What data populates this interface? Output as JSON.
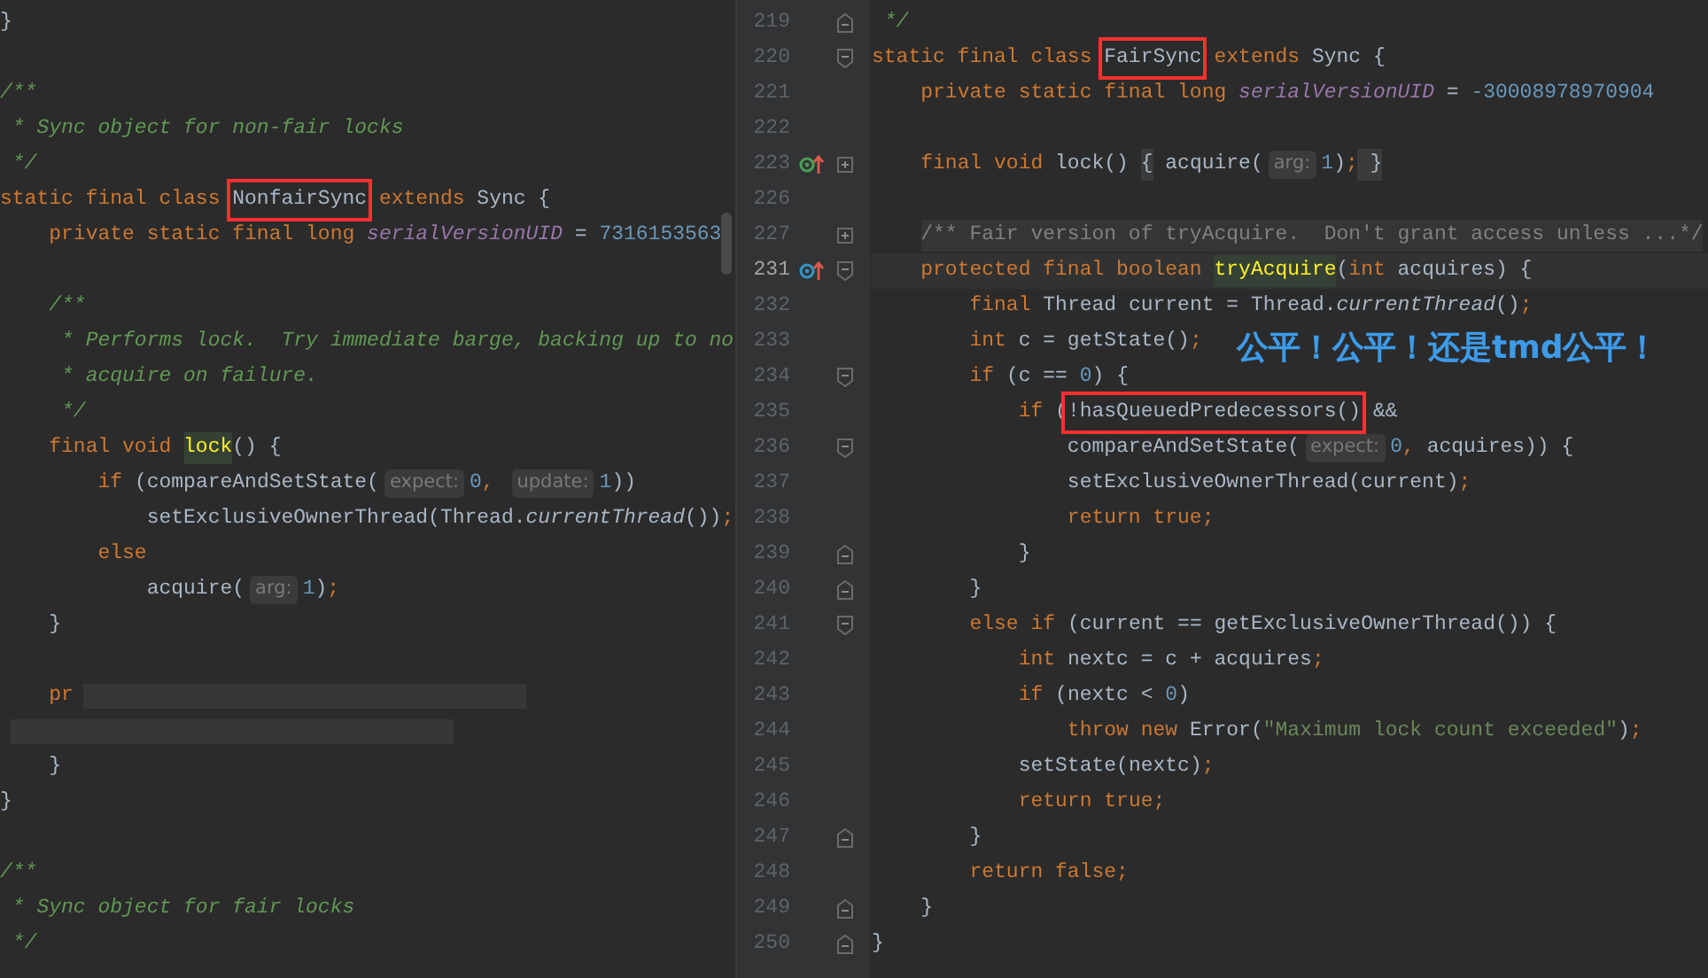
{
  "left_editor": {
    "lines": [
      {
        "tokens": [
          {
            "text": "}",
            "kind": "p"
          }
        ]
      },
      {
        "blank_before": true,
        "tokens": [
          {
            "text": "/**",
            "kind": "c"
          }
        ]
      },
      {
        "tokens": [
          {
            "text": " * Sync object for non-fair locks",
            "kind": "c"
          }
        ]
      },
      {
        "tokens": [
          {
            "text": " */",
            "kind": "c"
          }
        ]
      },
      {
        "tokens": [
          {
            "text": "static final class ",
            "kind": "k"
          },
          {
            "text": "NonfairSync",
            "kind": "b"
          },
          {
            "text": " extends ",
            "kind": "k"
          },
          {
            "text": "Sync {",
            "kind": "p"
          }
        ]
      },
      {
        "tokens": [
          {
            "text": "    private static final long ",
            "kind": "k"
          },
          {
            "text": "serialVersionUID",
            "kind": "f"
          },
          {
            "text": " = ",
            "kind": "p"
          },
          {
            "text": "7316153563",
            "kind": "n"
          }
        ]
      },
      {
        "blank_before": true,
        "tokens": [
          {
            "text": "    /**",
            "kind": "c"
          }
        ]
      },
      {
        "tokens": [
          {
            "text": "     * Performs lock.  Try immediate barge, backing up to no",
            "kind": "c"
          }
        ]
      },
      {
        "tokens": [
          {
            "text": "     * acquire on failure.",
            "kind": "c"
          }
        ]
      },
      {
        "tokens": [
          {
            "text": "     */",
            "kind": "c"
          }
        ]
      },
      {
        "tokens": [
          {
            "text": "    final void ",
            "kind": "k"
          },
          {
            "text": "lock",
            "kind": "u"
          },
          {
            "text": "() {",
            "kind": "p"
          }
        ]
      },
      {
        "tokens": [
          {
            "text": "        if ",
            "kind": "k"
          },
          {
            "text": "(compareAndSetState(",
            "kind": "p"
          },
          {
            "text": "expect:",
            "kind": "h"
          },
          {
            "text": "0",
            "kind": "n"
          },
          {
            "text": ", ",
            "kind": "k"
          },
          {
            "text": "update:",
            "kind": "h"
          },
          {
            "text": "1",
            "kind": "n"
          },
          {
            "text": "))",
            "kind": "p"
          }
        ]
      },
      {
        "tokens": [
          {
            "text": "            setExclusiveOwnerThread(Thread.",
            "kind": "p"
          },
          {
            "text": "currentThread",
            "kind": "i"
          },
          {
            "text": "())",
            "kind": "p"
          },
          {
            "text": ";",
            "kind": "k"
          }
        ]
      },
      {
        "tokens": [
          {
            "text": "        else",
            "kind": "k"
          }
        ]
      },
      {
        "tokens": [
          {
            "text": "            acquire(",
            "kind": "p"
          },
          {
            "text": "arg:",
            "kind": "h"
          },
          {
            "text": "1",
            "kind": "n"
          },
          {
            "text": ")",
            "kind": "p"
          },
          {
            "text": ";",
            "kind": "k"
          }
        ]
      },
      {
        "tokens": [
          {
            "text": "    }",
            "kind": "p"
          }
        ]
      },
      {
        "blank_before": true,
        "tokens": [
          {
            "text": "    pr",
            "kind": "k"
          }
        ],
        "redacted": true
      },
      {
        "redacted": true
      },
      {
        "tokens": [
          {
            "text": "    }",
            "kind": "p"
          }
        ]
      },
      {
        "tokens": [
          {
            "text": "}",
            "kind": "p"
          }
        ]
      },
      {
        "blank_before": true,
        "tokens": [
          {
            "text": "/**",
            "kind": "c"
          }
        ]
      },
      {
        "tokens": [
          {
            "text": " * Sync object for fair locks",
            "kind": "c"
          }
        ]
      },
      {
        "tokens": [
          {
            "text": " */",
            "kind": "c"
          }
        ]
      }
    ]
  },
  "right_editor": {
    "lines": [
      {
        "number": "219",
        "current": false,
        "fold": {
          "kind": "end"
        },
        "tokens": [
          {
            "text": " */",
            "kind": "c"
          }
        ]
      },
      {
        "number": "220",
        "current": false,
        "fold": {
          "kind": "start"
        },
        "tokens": [
          {
            "text": "static final class ",
            "kind": "k"
          },
          {
            "text": "FairSync",
            "kind": "b"
          },
          {
            "text": " extends ",
            "kind": "k"
          },
          {
            "text": "Sync {",
            "kind": "p"
          }
        ]
      },
      {
        "number": "221",
        "current": false,
        "tokens": [
          {
            "text": "    private static final long ",
            "kind": "k"
          },
          {
            "text": "serialVersionUID",
            "kind": "f"
          },
          {
            "text": " = ",
            "kind": "p"
          },
          {
            "text": "-30008978970904",
            "kind": "n"
          }
        ]
      },
      {
        "number": "222",
        "current": false
      },
      {
        "number": "223",
        "current": false,
        "fold": {
          "kind": "collapsed"
        },
        "marker": {
          "kind": "implements"
        },
        "tokens": [
          {
            "text": "    final void ",
            "kind": "k"
          },
          {
            "text": "lock() ",
            "kind": "p"
          },
          {
            "text": "{",
            "kind": "d"
          },
          {
            "text": " acquire(",
            "kind": "p"
          },
          {
            "text": "arg:",
            "kind": "h"
          },
          {
            "text": "1",
            "kind": "n"
          },
          {
            "text": ")",
            "kind": "p"
          },
          {
            "text": ";",
            "kind": "k"
          },
          {
            "text": " }",
            "kind": "d"
          }
        ]
      },
      {
        "number": "226",
        "current": false
      },
      {
        "number": "227",
        "current": false,
        "fold": {
          "kind": "collapsed"
        },
        "tokens": [
          {
            "text": "    /** Fair version of tryAcquire.  Don't grant access unless ...*/",
            "kind": "g"
          }
        ]
      },
      {
        "number": "231",
        "current": true,
        "fold": {
          "kind": "start"
        },
        "marker": {
          "kind": "overrides"
        },
        "tokens": [
          {
            "text": "    protected final boolean ",
            "kind": "k"
          },
          {
            "text": "tryAcquire",
            "kind": "u"
          },
          {
            "text": "(",
            "kind": "p"
          },
          {
            "text": "int ",
            "kind": "k"
          },
          {
            "text": "acquires) {",
            "kind": "p"
          }
        ]
      },
      {
        "number": "232",
        "current": false,
        "tokens": [
          {
            "text": "        final ",
            "kind": "k"
          },
          {
            "text": "Thread current = Thread.",
            "kind": "p"
          },
          {
            "text": "currentThread",
            "kind": "i"
          },
          {
            "text": "()",
            "kind": "p"
          },
          {
            "text": ";",
            "kind": "k"
          }
        ]
      },
      {
        "number": "233",
        "current": false,
        "tokens": [
          {
            "text": "        int ",
            "kind": "k"
          },
          {
            "text": "c = getState()",
            "kind": "p"
          },
          {
            "text": ";",
            "kind": "k"
          }
        ]
      },
      {
        "number": "234",
        "current": false,
        "fold": {
          "kind": "start"
        },
        "tokens": [
          {
            "text": "        if ",
            "kind": "k"
          },
          {
            "text": "(c == ",
            "kind": "p"
          },
          {
            "text": "0",
            "kind": "n"
          },
          {
            "text": ") {",
            "kind": "p"
          }
        ]
      },
      {
        "number": "235",
        "current": false,
        "tokens": [
          {
            "text": "            if ",
            "kind": "k"
          },
          {
            "text": "(",
            "kind": "p"
          },
          {
            "text": "!hasQueuedPredecessors()",
            "kind": "b"
          },
          {
            "text": " &&",
            "kind": "p"
          }
        ]
      },
      {
        "number": "236",
        "current": false,
        "fold": {
          "kind": "start"
        },
        "tokens": [
          {
            "text": "                compareAndSetState(",
            "kind": "p"
          },
          {
            "text": "expect:",
            "kind": "h"
          },
          {
            "text": "0",
            "kind": "n"
          },
          {
            "text": ", ",
            "kind": "k"
          },
          {
            "text": "acquires)) {",
            "kind": "p"
          }
        ]
      },
      {
        "number": "237",
        "current": false,
        "tokens": [
          {
            "text": "                setExclusiveOwnerThread(current)",
            "kind": "p"
          },
          {
            "text": ";",
            "kind": "k"
          }
        ]
      },
      {
        "number": "238",
        "current": false,
        "tokens": [
          {
            "text": "                return true;",
            "kind": "k"
          }
        ]
      },
      {
        "number": "239",
        "current": false,
        "fold": {
          "kind": "end"
        },
        "tokens": [
          {
            "text": "            }",
            "kind": "p"
          }
        ]
      },
      {
        "number": "240",
        "current": false,
        "fold": {
          "kind": "end"
        },
        "tokens": [
          {
            "text": "        }",
            "kind": "p"
          }
        ]
      },
      {
        "number": "241",
        "current": false,
        "fold": {
          "kind": "start"
        },
        "tokens": [
          {
            "text": "        else if ",
            "kind": "k"
          },
          {
            "text": "(current == getExclusiveOwnerThread()) {",
            "kind": "p"
          }
        ]
      },
      {
        "number": "242",
        "current": false,
        "tokens": [
          {
            "text": "            int ",
            "kind": "k"
          },
          {
            "text": "nextc = c + acquires",
            "kind": "p"
          },
          {
            "text": ";",
            "kind": "k"
          }
        ]
      },
      {
        "number": "243",
        "current": false,
        "tokens": [
          {
            "text": "            if ",
            "kind": "k"
          },
          {
            "text": "(nextc < ",
            "kind": "p"
          },
          {
            "text": "0",
            "kind": "n"
          },
          {
            "text": ")",
            "kind": "p"
          }
        ]
      },
      {
        "number": "244",
        "current": false,
        "tokens": [
          {
            "text": "                throw new ",
            "kind": "k"
          },
          {
            "text": "Error(",
            "kind": "p"
          },
          {
            "text": "\"Maximum lock count exceeded\"",
            "kind": "s"
          },
          {
            "text": ")",
            "kind": "p"
          },
          {
            "text": ";",
            "kind": "k"
          }
        ]
      },
      {
        "number": "245",
        "current": false,
        "tokens": [
          {
            "text": "            setState(nextc)",
            "kind": "p"
          },
          {
            "text": ";",
            "kind": "k"
          }
        ]
      },
      {
        "number": "246",
        "current": false,
        "tokens": [
          {
            "text": "            return true;",
            "kind": "k"
          }
        ]
      },
      {
        "number": "247",
        "current": false,
        "fold": {
          "kind": "end"
        },
        "tokens": [
          {
            "text": "        }",
            "kind": "p"
          }
        ]
      },
      {
        "number": "248",
        "current": false,
        "tokens": [
          {
            "text": "        return false;",
            "kind": "k"
          }
        ]
      },
      {
        "number": "249",
        "current": false,
        "fold": {
          "kind": "end"
        },
        "tokens": [
          {
            "text": "    }",
            "kind": "p"
          }
        ]
      },
      {
        "number": "250",
        "current": false,
        "fold": {
          "kind": "end"
        },
        "tokens": [
          {
            "text": "}",
            "kind": "p"
          }
        ]
      }
    ],
    "annotation": "公平！公平！还是tmd公平！"
  }
}
